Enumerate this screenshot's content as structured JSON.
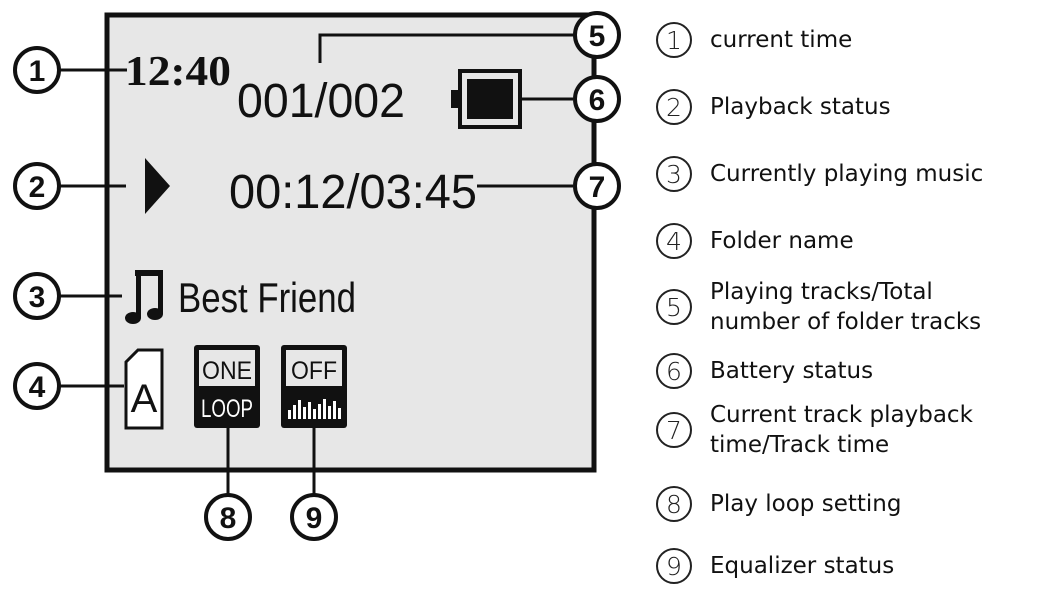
{
  "display": {
    "time": "12:40",
    "track_count": "001/002",
    "playback_time": "00:12/03:45",
    "song_title": "Best Friend",
    "folder": "A",
    "loop_top": "ONE",
    "loop_bottom": "LOOP",
    "eq": "OFF"
  },
  "callouts": [
    "1",
    "2",
    "3",
    "4",
    "5",
    "6",
    "7",
    "8",
    "9"
  ],
  "legend": [
    {
      "num": "1",
      "lines": [
        "current time"
      ]
    },
    {
      "num": "2",
      "lines": [
        "Playback status"
      ]
    },
    {
      "num": "3",
      "lines": [
        "Currently playing music"
      ]
    },
    {
      "num": "4",
      "lines": [
        "Folder name"
      ]
    },
    {
      "num": "5",
      "lines": [
        "Playing tracks/Total",
        "number of folder tracks"
      ]
    },
    {
      "num": "6",
      "lines": [
        "Battery status"
      ]
    },
    {
      "num": "7",
      "lines": [
        "Current track playback",
        "time/Track time"
      ]
    },
    {
      "num": "8",
      "lines": [
        "Play loop setting"
      ]
    },
    {
      "num": "9",
      "lines": [
        "Equalizer status"
      ]
    }
  ],
  "colors": {
    "screen": "#e7e7e7",
    "ink": "#111111"
  }
}
